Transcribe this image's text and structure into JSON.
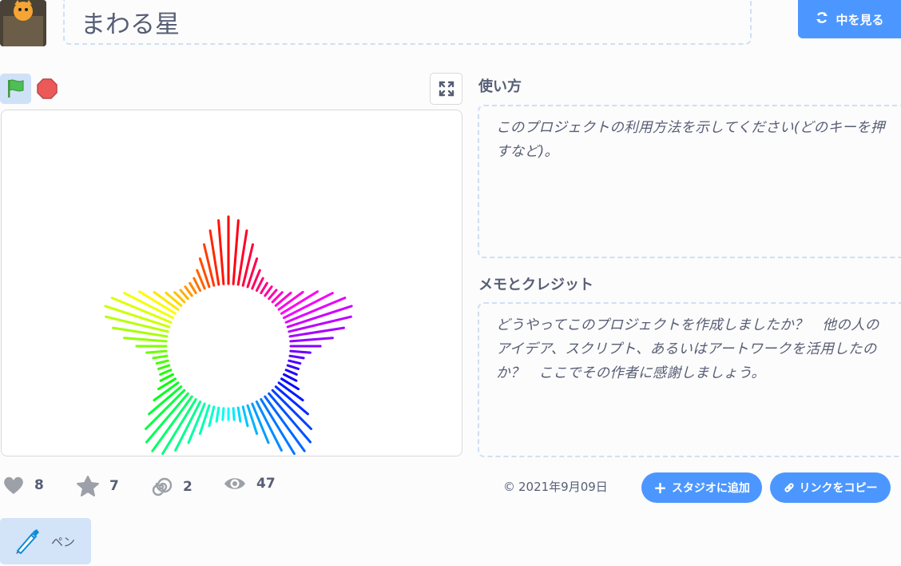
{
  "project": {
    "title": "まわる星",
    "see_inside_label": "中を見る"
  },
  "instructions": {
    "heading": "使い方",
    "placeholder": "このプロジェクトの利用方法を示してください(どのキーを押すなど)。"
  },
  "notes": {
    "heading": "メモとクレジット",
    "placeholder": "どうやってこのプロジェクトを作成しましたか？　他の人のアイデア、スクリプト、あるいはアートワークを活用したのか？　ここでその作者に感謝しましょう。"
  },
  "stats": {
    "loves": "8",
    "favorites": "7",
    "remixes": "2",
    "views": "47"
  },
  "date": "2021年9月09日",
  "actions": {
    "add_to_studio": "スタジオに追加",
    "copy_link": "リンクをコピー"
  },
  "extension": {
    "label": "ペン"
  },
  "colors": {
    "accent": "#4c97ff",
    "text": "#575e75"
  }
}
